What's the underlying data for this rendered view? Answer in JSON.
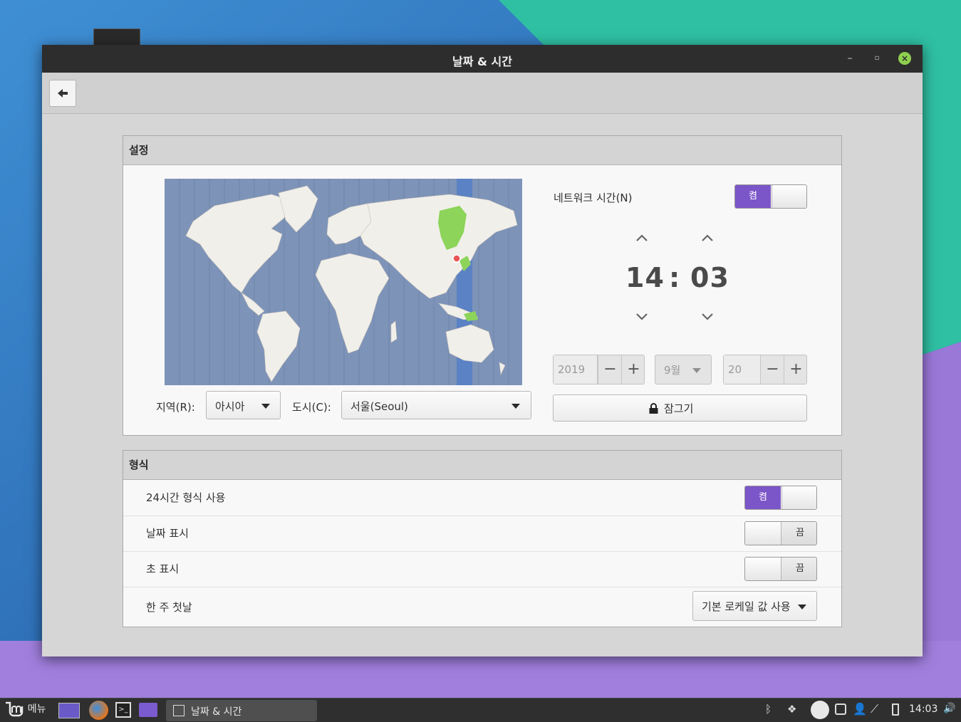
{
  "window": {
    "title": "날짜 & 시간"
  },
  "settings": {
    "header": "설정",
    "region_label": "지역(R):",
    "region_value": "아시아",
    "city_label": "도시(C):",
    "city_value": "서울(Seoul)",
    "network_time_label": "네트워크 시간(N)",
    "network_time_state": "켬",
    "hour": "14",
    "separator": ":",
    "minute": "03",
    "year": "2019",
    "month": "9월",
    "day": "20",
    "lock_label": "잠그기"
  },
  "formats": {
    "header": "형식",
    "rows": [
      {
        "label": "24시간 형식 사용",
        "state": "켬"
      },
      {
        "label": "날짜 표시",
        "state": "끔"
      },
      {
        "label": "초 표시",
        "state": "끔"
      },
      {
        "label": "한 주 첫날",
        "value": "기본 로케일 값 사용"
      }
    ]
  },
  "panel": {
    "menu_label": "메뉴",
    "task_label": "날짜 & 시간",
    "clock": "14:03"
  },
  "colors": {
    "accent": "#7b56c8",
    "map_ocean": "#7e93b8",
    "timezone_band": "#5b82c4",
    "selected_region": "#8cd45a"
  }
}
